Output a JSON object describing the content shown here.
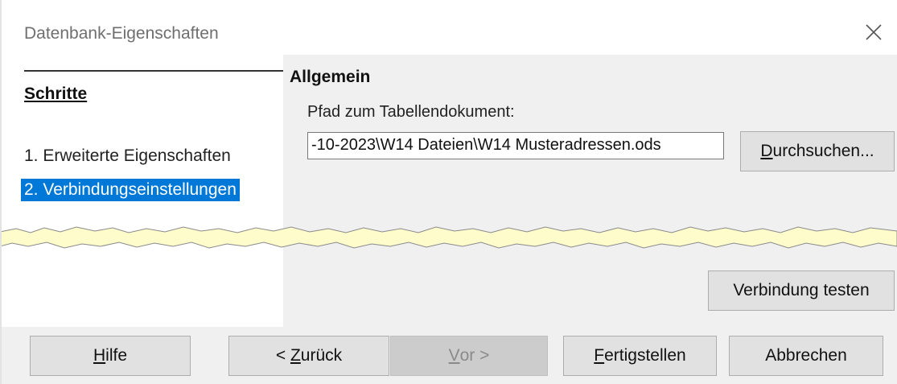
{
  "window": {
    "title": "Datenbank-Eigenschaften",
    "close_icon": "close-icon"
  },
  "roadmap": {
    "heading": "Schritte",
    "steps": [
      {
        "label": "1. Erweiterte Eigenschaften",
        "selected": false
      },
      {
        "label": "2. Verbindungseinstellungen",
        "selected": true
      }
    ]
  },
  "content": {
    "section_title": "Allgemein",
    "path_label": "Pfad zum Tabellendokument:",
    "path_value": "-10-2023\\W14 Dateien\\W14 Musteradressen.ods",
    "browse_button": {
      "mnemonic": "D",
      "rest": "urchsuchen..."
    },
    "test_button": {
      "before": "Verbindun",
      "mnemonic": "g",
      "after": " testen"
    }
  },
  "footer": {
    "help": {
      "mnemonic": "H",
      "rest": "ilfe"
    },
    "back": {
      "before": "< ",
      "mnemonic": "Z",
      "rest": "urück"
    },
    "next": {
      "mnemonic": "V",
      "rest": "or >"
    },
    "finish": {
      "mnemonic": "F",
      "rest": "ertigstellen"
    },
    "cancel": "Abbrechen"
  },
  "colors": {
    "selection": "#0078d7",
    "panel": "#f0f0f0",
    "button": "#e1e1e1",
    "tear": "#fffccc"
  }
}
